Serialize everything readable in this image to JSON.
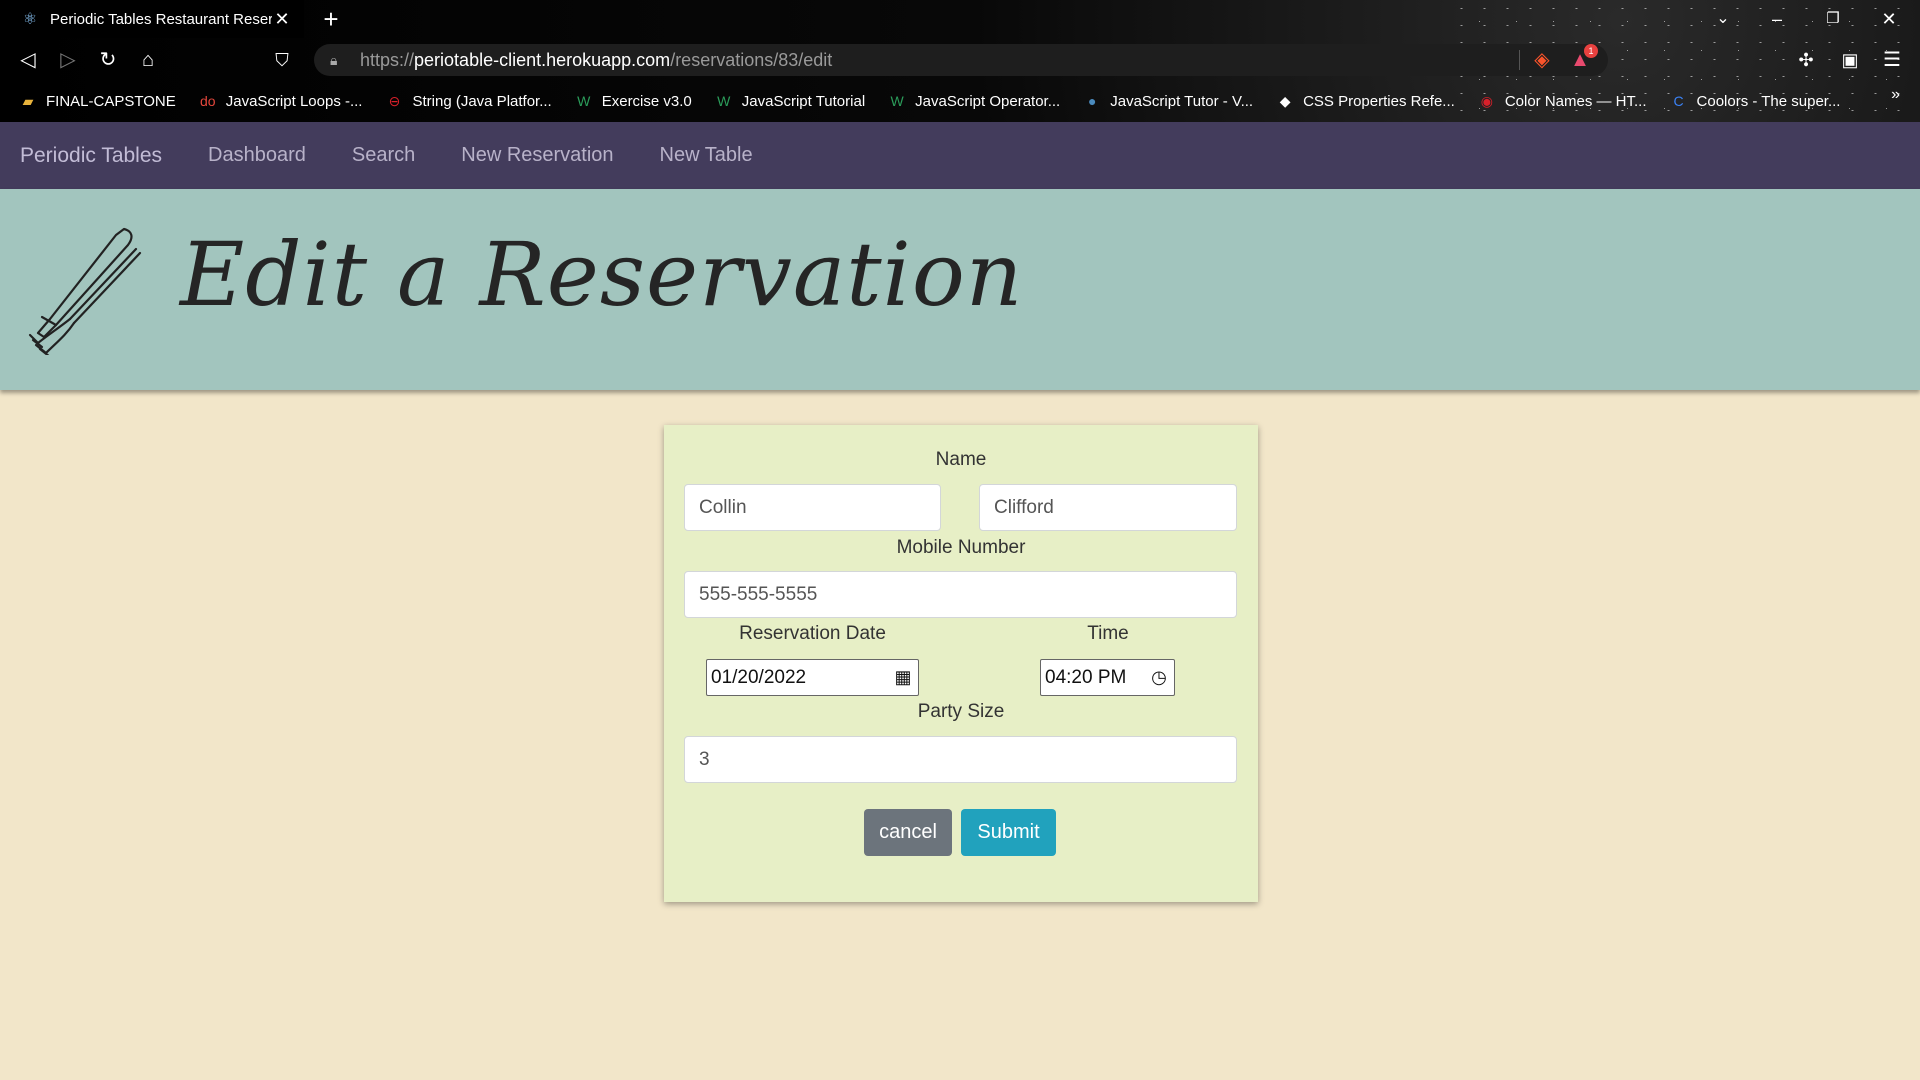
{
  "browser": {
    "tab_title": "Periodic Tables Restaurant Reserv",
    "url_scheme": "https://",
    "url_host": "periotable-client.herokuapp.com",
    "url_path": "/reservations/83/edit",
    "rewards_badge": "1",
    "bookmarks": [
      {
        "label": "FINAL-CAPSTONE",
        "icon": "folder-icon",
        "glyph": "▰",
        "color": "#e8b33c"
      },
      {
        "label": "JavaScript Loops -...",
        "icon": "do-icon",
        "glyph": "do",
        "color": "#e4473c"
      },
      {
        "label": "String (Java Platfor...",
        "icon": "oracle-icon",
        "glyph": "⊖",
        "color": "#d8202a"
      },
      {
        "label": "Exercise v3.0",
        "icon": "w3schools-icon",
        "glyph": "W",
        "color": "#2b9c5a"
      },
      {
        "label": "JavaScript Tutorial",
        "icon": "w3schools-icon",
        "glyph": "W",
        "color": "#2b9c5a"
      },
      {
        "label": "JavaScript Operator...",
        "icon": "w3schools-icon",
        "glyph": "W",
        "color": "#2b9c5a"
      },
      {
        "label": "JavaScript Tutor - V...",
        "icon": "python-icon",
        "glyph": "●",
        "color": "#4b8bbe"
      },
      {
        "label": "CSS Properties Refe...",
        "icon": "css-ref-icon",
        "glyph": "◆",
        "color": "#ffffff"
      },
      {
        "label": "Color Names — HT...",
        "icon": "color-names-icon",
        "glyph": "◉",
        "color": "#d8202a"
      },
      {
        "label": "Coolors - The super...",
        "icon": "coolors-icon",
        "glyph": "C",
        "color": "#3b82f6"
      }
    ],
    "bookmarks_more": "»"
  },
  "nav": {
    "brand": "Periodic Tables",
    "links": [
      "Dashboard",
      "Search",
      "New Reservation",
      "New Table"
    ]
  },
  "banner": {
    "heading": "Edit a Reservation"
  },
  "form": {
    "name_label": "Name",
    "first_name": "Collin",
    "last_name": "Clifford",
    "mobile_label": "Mobile Number",
    "mobile_number": "555-555-5555",
    "date_label": "Reservation Date",
    "date_value": "01/20/2022",
    "time_label": "Time",
    "time_value": "04:20 PM",
    "party_label": "Party Size",
    "party_size": "3",
    "cancel_label": "cancel",
    "submit_label": "Submit"
  },
  "colors": {
    "navbar": "#433c5c",
    "banner": "#a2c5be",
    "page_background": "#f2e6c9",
    "card": "#e7efc6",
    "submit": "#21a2bd",
    "cancel": "#6c747c"
  }
}
